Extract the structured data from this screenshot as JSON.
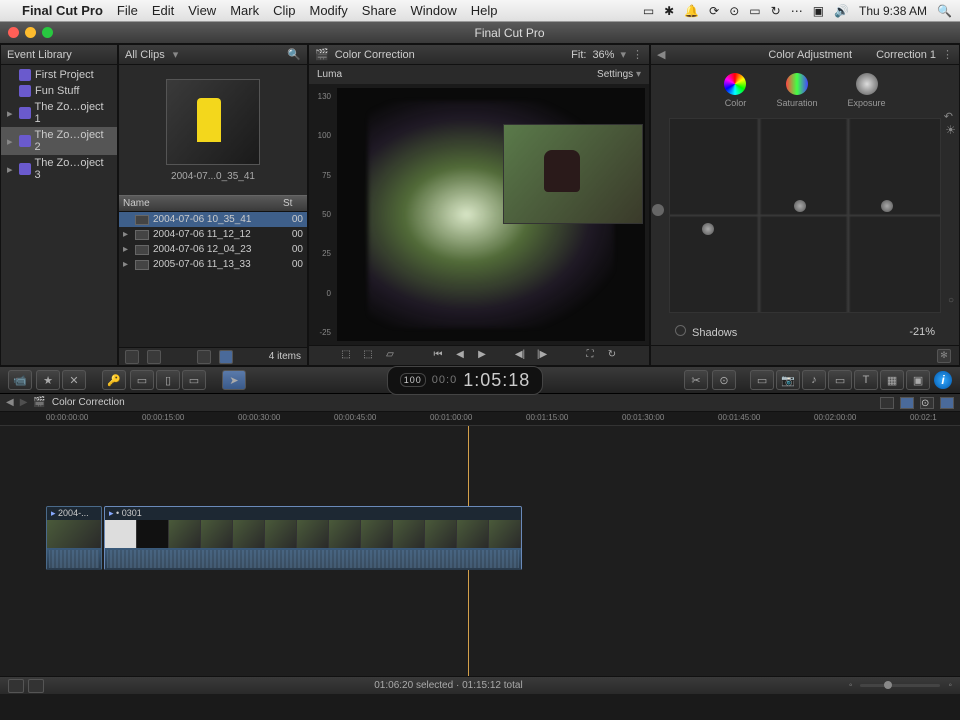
{
  "menubar": {
    "app": "Final Cut Pro",
    "items": [
      "File",
      "Edit",
      "View",
      "Mark",
      "Clip",
      "Modify",
      "Share",
      "Window",
      "Help"
    ],
    "clock": "Thu 9:38 AM"
  },
  "window": {
    "title": "Final Cut Pro"
  },
  "event_library": {
    "title": "Event Library",
    "items": [
      {
        "label": "First Project",
        "arrow": ""
      },
      {
        "label": "Fun Stuff",
        "arrow": ""
      },
      {
        "label": "The Zo…oject 1",
        "arrow": "▸"
      },
      {
        "label": "The Zo…oject 2",
        "arrow": "▸",
        "selected": true
      },
      {
        "label": "The Zo…oject 3",
        "arrow": "▸"
      }
    ]
  },
  "browser": {
    "all_clips": "All Clips",
    "thumb_label": "2004-07...0_35_41",
    "columns": {
      "name": "Name",
      "st": "St"
    },
    "rows": [
      {
        "name": "2004-07-06 10_35_41",
        "st": "00",
        "selected": true,
        "expandable": false
      },
      {
        "name": "2004-07-06 11_12_12",
        "st": "00",
        "expandable": true
      },
      {
        "name": "2004-07-06 12_04_23",
        "st": "00",
        "expandable": true
      },
      {
        "name": "2005-07-06 11_13_33",
        "st": "00",
        "expandable": true
      }
    ],
    "footer_count": "4 items"
  },
  "viewer": {
    "title": "Color Correction",
    "fit_label": "Fit:",
    "fit_value": "36%",
    "scope": {
      "mode": "Luma",
      "settings": "Settings"
    },
    "scale": [
      "130",
      "100",
      "75",
      "50",
      "25",
      "0",
      "-25"
    ]
  },
  "inspector": {
    "section": "Color Adjustment",
    "correction": "Correction 1",
    "tabs": {
      "color": "Color",
      "saturation": "Saturation",
      "exposure": "Exposure"
    },
    "param": {
      "name": "Shadows",
      "value": "-21%"
    }
  },
  "toolbar": {
    "timecode_small": "00:0",
    "timecode": "1:05:18"
  },
  "timeline": {
    "title": "Color Correction",
    "ticks": [
      "00:00:00:00",
      "00:00:15:00",
      "00:00:30:00",
      "00:00:45:00",
      "00:01:00:00",
      "00:01:15:00",
      "00:01:30:00",
      "00:01:45:00",
      "00:02:00:00",
      "00:02:1"
    ],
    "clips": [
      {
        "title": "2004-..."
      },
      {
        "title": "0301"
      }
    ]
  },
  "status": {
    "text": "01:06:20 selected · 01:15:12 total"
  }
}
